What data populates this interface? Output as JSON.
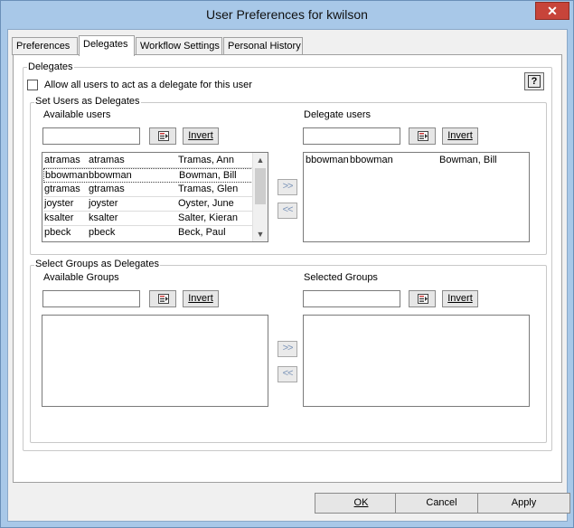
{
  "window": {
    "title": "User Preferences for kwilson",
    "close_glyph": "✕"
  },
  "tabs": [
    {
      "label": "Preferences",
      "active": false
    },
    {
      "label": "Delegates",
      "active": true
    },
    {
      "label": "Workflow Settings",
      "active": false
    },
    {
      "label": "Personal History",
      "active": false
    }
  ],
  "delegates": {
    "legend": "Delegates",
    "allow_all_label": "Allow all users to act as a delegate for this user",
    "allow_all_checked": false,
    "help_glyph": "?",
    "users": {
      "legend": "Set Users as Delegates",
      "available_label": "Available users",
      "available_filter_value": "",
      "invert_label": "Invert",
      "available_rows": [
        {
          "id": "atramas",
          "login": "atramas",
          "name": "Tramas, Ann"
        },
        {
          "id": "bbowman",
          "login": "bbowman",
          "name": "Bowman, Bill",
          "selected": true
        },
        {
          "id": "gtramas",
          "login": "gtramas",
          "name": "Tramas, Glen"
        },
        {
          "id": "joyster",
          "login": "joyster",
          "name": "Oyster, June"
        },
        {
          "id": "ksalter",
          "login": "ksalter",
          "name": "Salter, Kieran"
        },
        {
          "id": "pbeck",
          "login": "pbeck",
          "name": "Beck, Paul"
        }
      ],
      "add_glyph": ">>",
      "remove_glyph": "<<",
      "delegate_label": "Delegate users",
      "delegate_filter_value": "",
      "delegate_rows": [
        {
          "id": "bbowman",
          "login": "bbowman",
          "name": "Bowman, Bill"
        }
      ]
    },
    "groups": {
      "legend": "Select Groups as Delegates",
      "available_label": "Available Groups",
      "available_filter_value": "",
      "invert_label": "Invert",
      "selected_label": "Selected Groups",
      "selected_filter_value": ""
    }
  },
  "footer": {
    "ok_label": "OK",
    "cancel_label": "Cancel",
    "apply_label": "Apply"
  },
  "colors": {
    "window_frame": "#a8c8e8",
    "close_button": "#c7443a",
    "dialog_bg": "#f0f0f0"
  }
}
